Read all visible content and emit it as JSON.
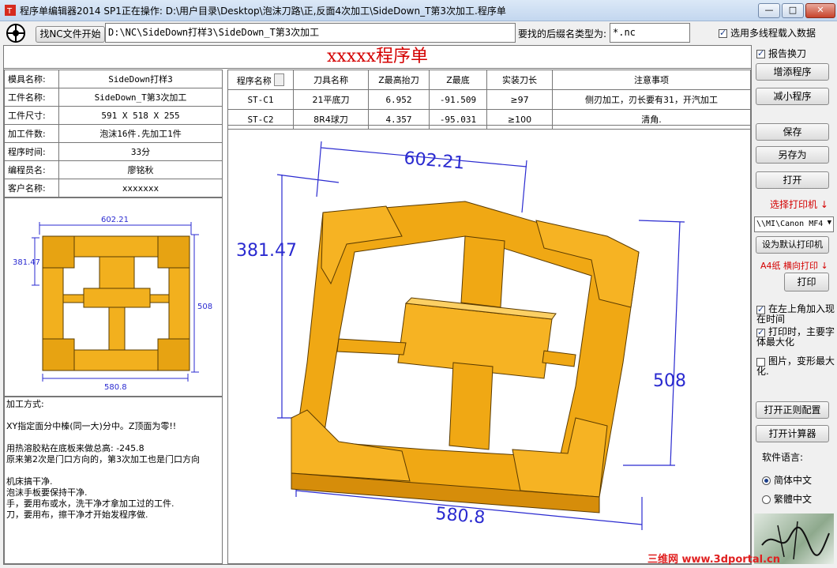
{
  "window": {
    "title": "程序单编辑器2014 SP1正在操作: D:\\用户目录\\Desktop\\泡沫刀路\\正,反面4次加工\\SideDown_T第3次加工.程序单",
    "minimize": "—",
    "maximize": "□",
    "close": "✕"
  },
  "toolbar": {
    "find_nc_button": "找NC文件开始",
    "path_value": "D:\\NC\\SideDown打样3\\SideDown_T第3次加工",
    "suffix_label": "要找的后缀名类型为:",
    "suffix_value": "*.nc",
    "multiline_label": "选用多线程载入数据"
  },
  "sidebar": {
    "report_tool_change": "报告换刀",
    "add_program": "增添程序",
    "remove_program": "减小程序",
    "save": "保存",
    "save_as": "另存为",
    "open": "打开",
    "select_printer": "选择打印机 ↓",
    "printer_value": "\\\\MI\\Canon MF4",
    "set_default_printer": "设为默认打印机",
    "paper_info": "A4纸  横向打印 ↓",
    "print": "打印",
    "opt_time_label": "在左上角加入现在时间",
    "opt_maximize_label": "打印时，主要字体最大化",
    "opt_deform_label": "图片，变形最大化.",
    "open_rule_config": "打开正则配置",
    "open_calculator": "打开计算器",
    "language_label": "软件语言:",
    "lang_simplified": "简体中文",
    "lang_traditional": "繁體中文"
  },
  "document": {
    "title": "xxxxx程序单",
    "info": [
      {
        "key": "模具名称:",
        "value": "SideDown打样3"
      },
      {
        "key": "工件名称:",
        "value": "SideDown_T第3次加工"
      },
      {
        "key": "工件尺寸:",
        "value": "591 X 518 X 255"
      },
      {
        "key": "加工件数:",
        "value": "泡沫16件.先加工1件"
      },
      {
        "key": "程序时间:",
        "value": "33分"
      },
      {
        "key": "编程员名:",
        "value": "廖铭秋"
      },
      {
        "key": "客户名称:",
        "value": "xxxxxxx"
      }
    ],
    "tool_headers": [
      "程序名称",
      "刀具名称",
      "Z最高抬刀",
      "Z最底",
      "实装刀长",
      "注意事项"
    ],
    "tool_rows": [
      [
        "ST-C1",
        "21平底刀",
        "6.952",
        "-91.509",
        "≥97",
        "侧刃加工，刃长要有31，开汽加工"
      ],
      [
        "ST-C2",
        "8R4球刀",
        "4.357",
        "-95.031",
        "≥100",
        "清角."
      ]
    ],
    "notes": [
      "加工方式:",
      "",
      "XY指定面分中榛(同一大)分中。Z顶面为零!!",
      "",
      "用热溶胶粘在底板来做总高:   -245.8",
      "原来第2次是门口方向的，第3次加工也是门口方向",
      "",
      "机床搞干净.",
      "泡沫手板要保持干净.",
      "手，要用布或水，洗干净才拿加工过的工件.",
      "刀，要用布，擦干净才开始发程序做."
    ],
    "dims": {
      "top": "602.21",
      "left": "381.47",
      "right": "508",
      "bottom": "580.8"
    },
    "thumb_dims": {
      "top": "602.21",
      "left": "381.47",
      "right": "508",
      "bottom": "580.8"
    }
  },
  "footer": {
    "watermark": "三维网 www.3dportal.cn",
    "signature": "廖铭秋"
  }
}
